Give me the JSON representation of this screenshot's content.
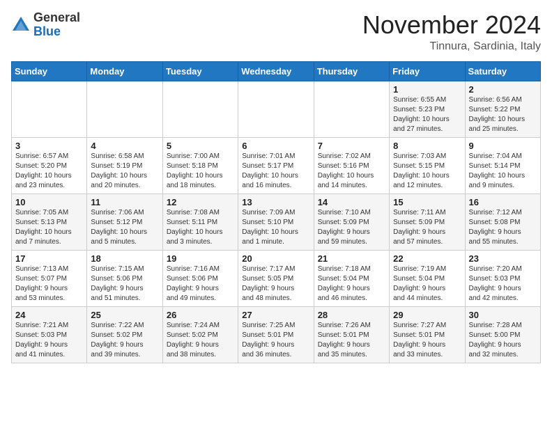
{
  "logo": {
    "general": "General",
    "blue": "Blue"
  },
  "header": {
    "month": "November 2024",
    "location": "Tinnura, Sardinia, Italy"
  },
  "weekdays": [
    "Sunday",
    "Monday",
    "Tuesday",
    "Wednesday",
    "Thursday",
    "Friday",
    "Saturday"
  ],
  "weeks": [
    [
      {
        "day": "",
        "info": ""
      },
      {
        "day": "",
        "info": ""
      },
      {
        "day": "",
        "info": ""
      },
      {
        "day": "",
        "info": ""
      },
      {
        "day": "",
        "info": ""
      },
      {
        "day": "1",
        "info": "Sunrise: 6:55 AM\nSunset: 5:23 PM\nDaylight: 10 hours\nand 27 minutes."
      },
      {
        "day": "2",
        "info": "Sunrise: 6:56 AM\nSunset: 5:22 PM\nDaylight: 10 hours\nand 25 minutes."
      }
    ],
    [
      {
        "day": "3",
        "info": "Sunrise: 6:57 AM\nSunset: 5:20 PM\nDaylight: 10 hours\nand 23 minutes."
      },
      {
        "day": "4",
        "info": "Sunrise: 6:58 AM\nSunset: 5:19 PM\nDaylight: 10 hours\nand 20 minutes."
      },
      {
        "day": "5",
        "info": "Sunrise: 7:00 AM\nSunset: 5:18 PM\nDaylight: 10 hours\nand 18 minutes."
      },
      {
        "day": "6",
        "info": "Sunrise: 7:01 AM\nSunset: 5:17 PM\nDaylight: 10 hours\nand 16 minutes."
      },
      {
        "day": "7",
        "info": "Sunrise: 7:02 AM\nSunset: 5:16 PM\nDaylight: 10 hours\nand 14 minutes."
      },
      {
        "day": "8",
        "info": "Sunrise: 7:03 AM\nSunset: 5:15 PM\nDaylight: 10 hours\nand 12 minutes."
      },
      {
        "day": "9",
        "info": "Sunrise: 7:04 AM\nSunset: 5:14 PM\nDaylight: 10 hours\nand 9 minutes."
      }
    ],
    [
      {
        "day": "10",
        "info": "Sunrise: 7:05 AM\nSunset: 5:13 PM\nDaylight: 10 hours\nand 7 minutes."
      },
      {
        "day": "11",
        "info": "Sunrise: 7:06 AM\nSunset: 5:12 PM\nDaylight: 10 hours\nand 5 minutes."
      },
      {
        "day": "12",
        "info": "Sunrise: 7:08 AM\nSunset: 5:11 PM\nDaylight: 10 hours\nand 3 minutes."
      },
      {
        "day": "13",
        "info": "Sunrise: 7:09 AM\nSunset: 5:10 PM\nDaylight: 10 hours\nand 1 minute."
      },
      {
        "day": "14",
        "info": "Sunrise: 7:10 AM\nSunset: 5:09 PM\nDaylight: 9 hours\nand 59 minutes."
      },
      {
        "day": "15",
        "info": "Sunrise: 7:11 AM\nSunset: 5:09 PM\nDaylight: 9 hours\nand 57 minutes."
      },
      {
        "day": "16",
        "info": "Sunrise: 7:12 AM\nSunset: 5:08 PM\nDaylight: 9 hours\nand 55 minutes."
      }
    ],
    [
      {
        "day": "17",
        "info": "Sunrise: 7:13 AM\nSunset: 5:07 PM\nDaylight: 9 hours\nand 53 minutes."
      },
      {
        "day": "18",
        "info": "Sunrise: 7:15 AM\nSunset: 5:06 PM\nDaylight: 9 hours\nand 51 minutes."
      },
      {
        "day": "19",
        "info": "Sunrise: 7:16 AM\nSunset: 5:06 PM\nDaylight: 9 hours\nand 49 minutes."
      },
      {
        "day": "20",
        "info": "Sunrise: 7:17 AM\nSunset: 5:05 PM\nDaylight: 9 hours\nand 48 minutes."
      },
      {
        "day": "21",
        "info": "Sunrise: 7:18 AM\nSunset: 5:04 PM\nDaylight: 9 hours\nand 46 minutes."
      },
      {
        "day": "22",
        "info": "Sunrise: 7:19 AM\nSunset: 5:04 PM\nDaylight: 9 hours\nand 44 minutes."
      },
      {
        "day": "23",
        "info": "Sunrise: 7:20 AM\nSunset: 5:03 PM\nDaylight: 9 hours\nand 42 minutes."
      }
    ],
    [
      {
        "day": "24",
        "info": "Sunrise: 7:21 AM\nSunset: 5:03 PM\nDaylight: 9 hours\nand 41 minutes."
      },
      {
        "day": "25",
        "info": "Sunrise: 7:22 AM\nSunset: 5:02 PM\nDaylight: 9 hours\nand 39 minutes."
      },
      {
        "day": "26",
        "info": "Sunrise: 7:24 AM\nSunset: 5:02 PM\nDaylight: 9 hours\nand 38 minutes."
      },
      {
        "day": "27",
        "info": "Sunrise: 7:25 AM\nSunset: 5:01 PM\nDaylight: 9 hours\nand 36 minutes."
      },
      {
        "day": "28",
        "info": "Sunrise: 7:26 AM\nSunset: 5:01 PM\nDaylight: 9 hours\nand 35 minutes."
      },
      {
        "day": "29",
        "info": "Sunrise: 7:27 AM\nSunset: 5:01 PM\nDaylight: 9 hours\nand 33 minutes."
      },
      {
        "day": "30",
        "info": "Sunrise: 7:28 AM\nSunset: 5:00 PM\nDaylight: 9 hours\nand 32 minutes."
      }
    ]
  ]
}
